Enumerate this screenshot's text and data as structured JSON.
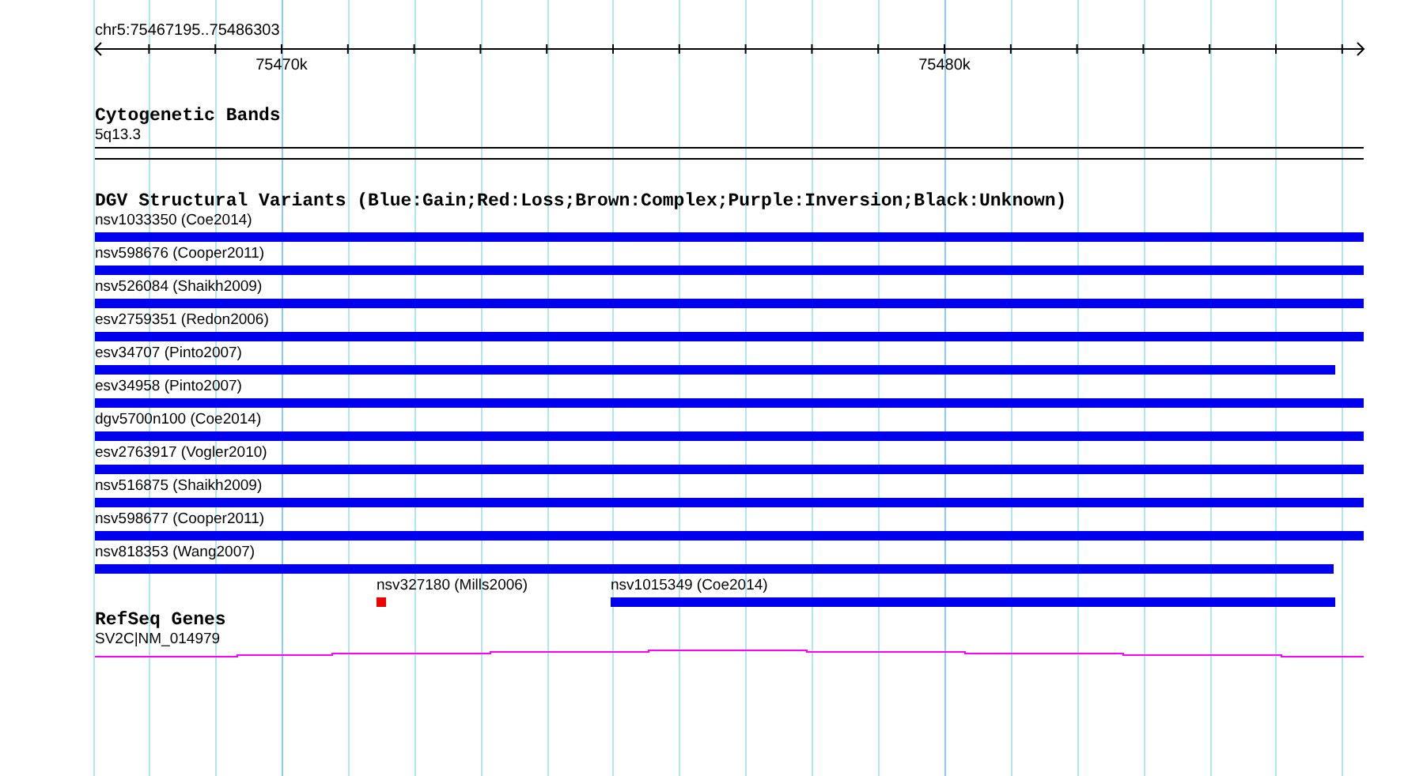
{
  "ruler": {
    "location": "chr5:75467195..75486303",
    "ticks": [
      "75470k",
      "75480k"
    ]
  },
  "cytogenetic_bands": {
    "title": "Cytogenetic Bands",
    "band": "5q13.3"
  },
  "structural_variants": {
    "title": "DGV Structural Variants (Blue:Gain;Red:Loss;Brown:Complex;Purple:Inversion;Black:Unknown)",
    "rows": [
      {
        "features": [
          {
            "label": "nsv1033350 (Coe2014)",
            "color": "#0000ee"
          }
        ]
      },
      {
        "features": [
          {
            "label": "nsv598676 (Cooper2011)",
            "color": "#0000ee"
          }
        ]
      },
      {
        "features": [
          {
            "label": "nsv526084 (Shaikh2009)",
            "color": "#0000ee"
          }
        ]
      },
      {
        "features": [
          {
            "label": "esv2759351 (Redon2006)",
            "color": "#0000ee"
          }
        ]
      },
      {
        "features": [
          {
            "label": "esv34707 (Pinto2007)",
            "color": "#0000ee"
          }
        ]
      },
      {
        "features": [
          {
            "label": "esv34958 (Pinto2007)",
            "color": "#0000ee"
          }
        ]
      },
      {
        "features": [
          {
            "label": "dgv5700n100 (Coe2014)",
            "color": "#0000ee"
          }
        ]
      },
      {
        "features": [
          {
            "label": "esv2763917 (Vogler2010)",
            "color": "#0000ee"
          }
        ]
      },
      {
        "features": [
          {
            "label": "nsv516875 (Shaikh2009)",
            "color": "#0000ee"
          }
        ]
      },
      {
        "features": [
          {
            "label": "nsv598677 (Cooper2011)",
            "color": "#0000ee"
          }
        ]
      },
      {
        "features": [
          {
            "label": "nsv818353 (Wang2007)",
            "color": "#0000ee"
          }
        ]
      },
      {
        "features": [
          {
            "label": "nsv327180 (Mills2006)",
            "color": "#ee0000"
          },
          {
            "label": "nsv1015349 (Coe2014)",
            "color": "#0000ee"
          }
        ]
      }
    ]
  },
  "refseq_genes": {
    "title": "RefSeq Genes",
    "gene": "SV2C|NM_014979"
  }
}
